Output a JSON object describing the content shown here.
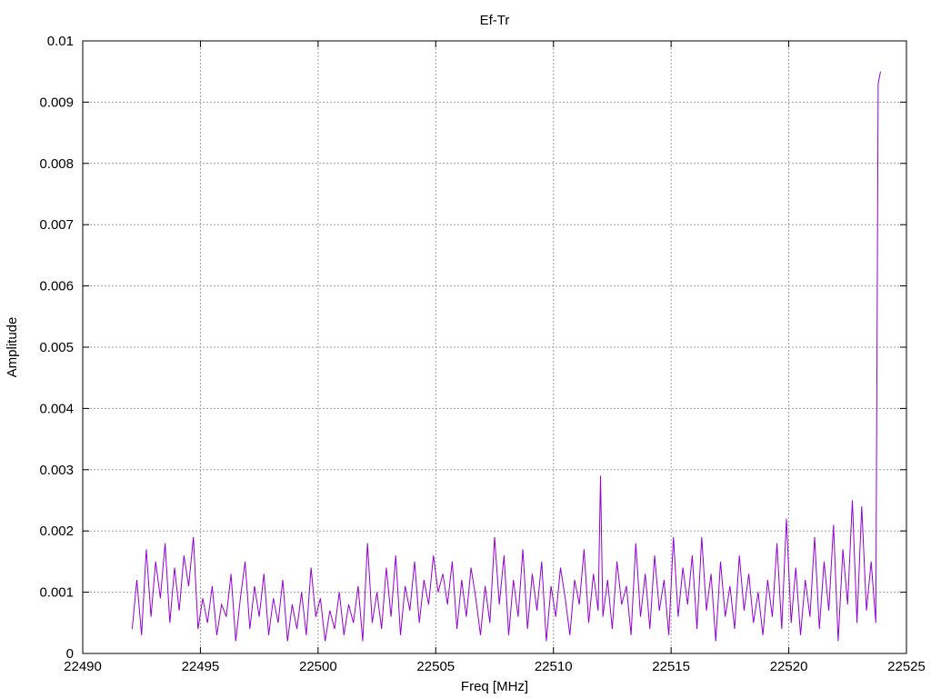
{
  "chart_data": {
    "type": "line",
    "title": "Ef-Tr",
    "xlabel": "Freq [MHz]",
    "ylabel": "Amplitude",
    "xlim": [
      22490,
      22525
    ],
    "ylim": [
      0,
      0.01
    ],
    "xticks": [
      22490,
      22495,
      22500,
      22505,
      22510,
      22515,
      22520,
      22525
    ],
    "xtick_labels": [
      "22490",
      "22495",
      "22500",
      "22505",
      "22510",
      "22515",
      "22520",
      "22525"
    ],
    "yticks": [
      0,
      0.001,
      0.002,
      0.003,
      0.004,
      0.005,
      0.006,
      0.007,
      0.008,
      0.009,
      0.01
    ],
    "ytick_labels": [
      "0",
      "0.001",
      "0.002",
      "0.003",
      "0.004",
      "0.005",
      "0.006",
      "0.007",
      "0.008",
      "0.009",
      "0.01"
    ],
    "grid": true,
    "line_color": "#9400d3",
    "x": [
      22492.1,
      22492.3,
      22492.5,
      22492.7,
      22492.9,
      22493.1,
      22493.3,
      22493.5,
      22493.7,
      22493.9,
      22494.1,
      22494.3,
      22494.5,
      22494.7,
      22494.9,
      22495.1,
      22495.3,
      22495.5,
      22495.7,
      22495.9,
      22496.1,
      22496.3,
      22496.5,
      22496.7,
      22496.9,
      22497.1,
      22497.3,
      22497.5,
      22497.7,
      22497.9,
      22498.1,
      22498.3,
      22498.5,
      22498.7,
      22498.9,
      22499.1,
      22499.3,
      22499.5,
      22499.7,
      22499.9,
      22500.1,
      22500.3,
      22500.5,
      22500.7,
      22500.9,
      22501.1,
      22501.3,
      22501.5,
      22501.7,
      22501.9,
      22502.1,
      22502.3,
      22502.5,
      22502.7,
      22502.9,
      22503.1,
      22503.3,
      22503.5,
      22503.7,
      22503.9,
      22504.1,
      22504.3,
      22504.5,
      22504.7,
      22504.9,
      22505.1,
      22505.3,
      22505.5,
      22505.7,
      22505.9,
      22506.1,
      22506.3,
      22506.5,
      22506.7,
      22506.9,
      22507.1,
      22507.3,
      22507.5,
      22507.7,
      22507.9,
      22508.1,
      22508.3,
      22508.5,
      22508.7,
      22508.9,
      22509.1,
      22509.3,
      22509.5,
      22509.7,
      22509.9,
      22510.1,
      22510.3,
      22510.5,
      22510.7,
      22510.9,
      22511.1,
      22511.3,
      22511.5,
      22511.7,
      22511.9,
      22512.0,
      22512.1,
      22512.3,
      22512.5,
      22512.7,
      22512.9,
      22513.1,
      22513.3,
      22513.5,
      22513.7,
      22513.9,
      22514.1,
      22514.3,
      22514.5,
      22514.7,
      22514.9,
      22515.1,
      22515.3,
      22515.5,
      22515.7,
      22515.9,
      22516.1,
      22516.3,
      22516.5,
      22516.7,
      22516.9,
      22517.1,
      22517.3,
      22517.5,
      22517.7,
      22517.9,
      22518.1,
      22518.3,
      22518.5,
      22518.7,
      22518.9,
      22519.1,
      22519.3,
      22519.5,
      22519.7,
      22519.9,
      22520.1,
      22520.3,
      22520.5,
      22520.7,
      22520.9,
      22521.1,
      22521.3,
      22521.5,
      22521.7,
      22521.9,
      22522.1,
      22522.3,
      22522.5,
      22522.7,
      22522.9,
      22523.1,
      22523.3,
      22523.5,
      22523.7,
      22523.8,
      22523.9,
      22524.0
    ],
    "y": [
      0.0004,
      0.0012,
      0.0003,
      0.0017,
      0.0006,
      0.0015,
      0.0009,
      0.0018,
      0.0005,
      0.0014,
      0.0007,
      0.0016,
      0.0011,
      0.0019,
      0.0004,
      0.0009,
      0.0005,
      0.0011,
      0.0003,
      0.0008,
      0.0006,
      0.0013,
      0.0002,
      0.0009,
      0.0015,
      0.0004,
      0.0011,
      0.0006,
      0.0013,
      0.0003,
      0.0009,
      0.0005,
      0.0012,
      0.0002,
      0.0008,
      0.0004,
      0.001,
      0.0003,
      0.0014,
      0.0006,
      0.0009,
      0.0002,
      0.0007,
      0.0004,
      0.001,
      0.0003,
      0.0008,
      0.0005,
      0.0011,
      0.0002,
      0.0018,
      0.0005,
      0.001,
      0.0004,
      0.0014,
      0.0006,
      0.0016,
      0.0003,
      0.0011,
      0.0007,
      0.0015,
      0.0005,
      0.0012,
      0.0008,
      0.0016,
      0.001,
      0.0013,
      0.0008,
      0.0015,
      0.0004,
      0.0012,
      0.0006,
      0.0014,
      0.0009,
      0.0003,
      0.0011,
      0.0005,
      0.0019,
      0.0008,
      0.0016,
      0.0003,
      0.0012,
      0.0006,
      0.0017,
      0.0004,
      0.0013,
      0.0007,
      0.0015,
      0.0002,
      0.0011,
      0.0006,
      0.0014,
      0.0009,
      0.0003,
      0.0012,
      0.0008,
      0.0017,
      0.0005,
      0.0013,
      0.0007,
      0.0029,
      0.0006,
      0.0012,
      0.0004,
      0.0015,
      0.0008,
      0.0011,
      0.0003,
      0.0018,
      0.0006,
      0.0013,
      0.0004,
      0.0016,
      0.0007,
      0.0012,
      0.0003,
      0.0019,
      0.0006,
      0.0014,
      0.0008,
      0.0016,
      0.0004,
      0.0019,
      0.0007,
      0.0013,
      0.0002,
      0.0015,
      0.0006,
      0.0011,
      0.0004,
      0.0016,
      0.0007,
      0.0013,
      0.0005,
      0.001,
      0.0003,
      0.0012,
      0.0006,
      0.0018,
      0.0004,
      0.0022,
      0.0005,
      0.0014,
      0.0003,
      0.0012,
      0.0006,
      0.0019,
      0.0004,
      0.0015,
      0.0007,
      0.0021,
      0.0002,
      0.0017,
      0.0008,
      0.0025,
      0.0005,
      0.0024,
      0.0007,
      0.0015,
      0.0005,
      0.0093,
      0.0095
    ]
  }
}
